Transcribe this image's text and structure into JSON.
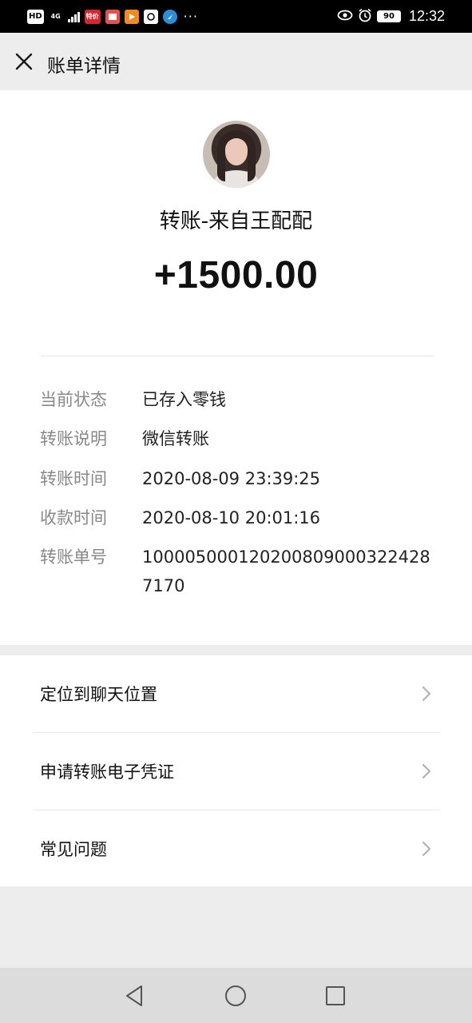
{
  "status_bar": {
    "hd": "HD",
    "network": "4G",
    "battery": "90",
    "time": "12:32",
    "more": "···",
    "app1_label": "特价"
  },
  "header": {
    "title": "账单详情"
  },
  "transfer": {
    "payer": "转账-来自王配配",
    "amount": "+1500.00"
  },
  "details": [
    {
      "label": "当前状态",
      "value": "已存入零钱"
    },
    {
      "label": "转账说明",
      "value": "微信转账"
    },
    {
      "label": "转账时间",
      "value": "2020-08-09 23:39:25"
    },
    {
      "label": "收款时间",
      "value": "2020-08-10 20:01:16"
    },
    {
      "label": "转账单号",
      "value": "1000050001202008090003224287170"
    }
  ],
  "actions": [
    {
      "label": "定位到聊天位置"
    },
    {
      "label": "申请转账电子凭证"
    },
    {
      "label": "常见问题"
    }
  ],
  "colors": {
    "background": "#ededed",
    "card": "#ffffff",
    "label_gray": "#888888",
    "text": "#111111"
  }
}
